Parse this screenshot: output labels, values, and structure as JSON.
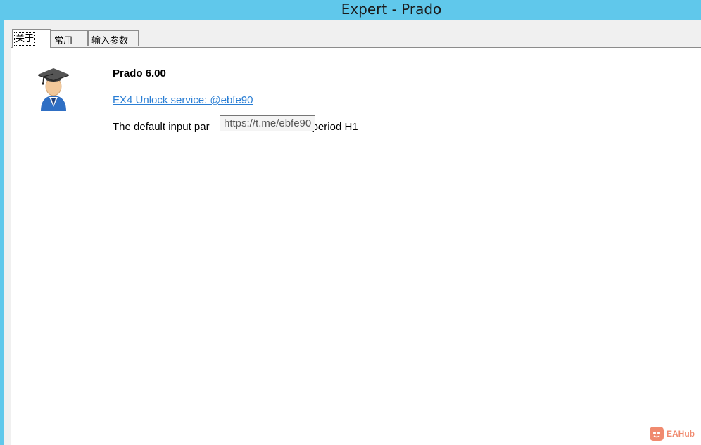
{
  "window": {
    "title": "Expert - Prado"
  },
  "tabs": [
    {
      "label": "关于",
      "active": true
    },
    {
      "label": "常用",
      "active": false
    },
    {
      "label": "输入参数",
      "active": false
    }
  ],
  "about": {
    "logo_icon": "graduate-user-icon",
    "product_name": "Prado 6.00",
    "unlock_link": "EX4 Unlock service: @ebfe90",
    "description_visible_start": "The default input par",
    "description_visible_end": "period H1",
    "tooltip_url": "https://t.me/ebfe90"
  },
  "watermark": {
    "icon": "eahub-logo-icon",
    "text": "EAHub"
  },
  "colors": {
    "titlebar": "#60c8eb",
    "link": "#2a7ed4",
    "watermark": "#f08a6f"
  }
}
